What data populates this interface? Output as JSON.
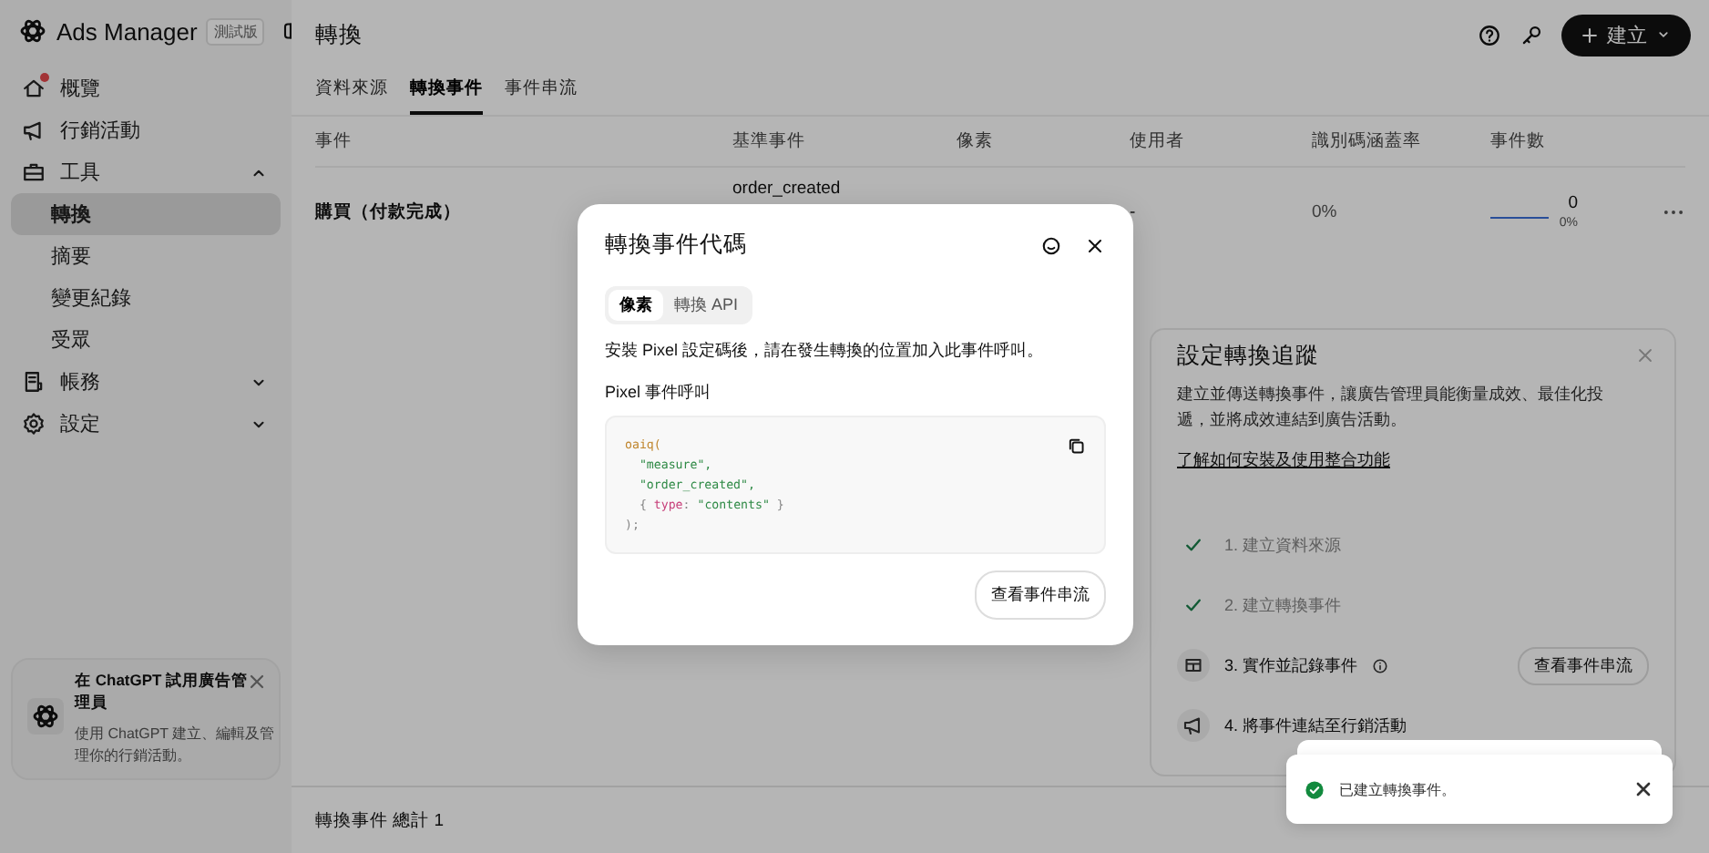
{
  "app": {
    "name": "Ads Manager",
    "badge": "測試版"
  },
  "sidebar": {
    "items": [
      {
        "label": "概覽",
        "notification": true,
        "selected": false
      },
      {
        "label": "行銷活動",
        "notification": false,
        "selected": false
      },
      {
        "label": "工具",
        "notification": false,
        "selected": false,
        "expanded": true,
        "children": [
          {
            "label": "轉換",
            "selected": true
          },
          {
            "label": "摘要",
            "selected": false
          },
          {
            "label": "變更紀錄",
            "selected": false
          },
          {
            "label": "受眾",
            "selected": false
          }
        ]
      },
      {
        "label": "帳務",
        "notification": false,
        "selected": false,
        "expanded": false
      },
      {
        "label": "設定",
        "notification": false,
        "selected": false,
        "expanded": false
      }
    ]
  },
  "promo": {
    "title": "在 ChatGPT 試用廣告管理員",
    "body": "使用 ChatGPT 建立、編輯及管理你的行銷活動。"
  },
  "header": {
    "title": "轉換",
    "create_button": "建立"
  },
  "tabs": [
    {
      "label": "資料來源",
      "selected": false
    },
    {
      "label": "轉換事件",
      "selected": true
    },
    {
      "label": "事件串流",
      "selected": false
    }
  ],
  "table": {
    "columns": [
      "事件",
      "基準事件",
      "像素",
      "使用者",
      "識別碼涵蓋率",
      "事件數"
    ],
    "rows": [
      {
        "event": "購買（付款完成）",
        "base_event": "order_created",
        "users": "-",
        "coverage": "0%",
        "count": "0",
        "count_share": "0%"
      }
    ]
  },
  "footer": "轉換事件 總計 1",
  "modal": {
    "title": "轉換事件代碼",
    "tabs": [
      {
        "label": "像素",
        "selected": true
      },
      {
        "label": "轉換 API",
        "selected": false
      }
    ],
    "description": "安裝 Pixel 設定碼後，請在發生轉換的位置加入此事件呼叫。",
    "code_label": "Pixel 事件呼叫",
    "code": [
      [
        {
          "text": "oaiq(",
          "kind": "fn"
        }
      ],
      [
        {
          "text": "  \"measure\",",
          "kind": "string"
        }
      ],
      [
        {
          "text": "  \"order_created\",",
          "kind": "string"
        }
      ],
      [
        {
          "text": "  { ",
          "kind": "punct"
        },
        {
          "text": "type",
          "kind": "key"
        },
        {
          "text": ": ",
          "kind": "punct"
        },
        {
          "text": "\"contents\"",
          "kind": "string"
        },
        {
          "text": " }",
          "kind": "punct"
        }
      ],
      [
        {
          "text": ");",
          "kind": "punct"
        }
      ]
    ],
    "button": "查看事件串流"
  },
  "setup": {
    "title": "設定轉換追蹤",
    "body": "建立並傳送轉換事件，讓廣告管理員能衡量成效、最佳化投遞，並將成效連結到廣告活動。",
    "link": "了解如何安裝及使用整合功能",
    "steps": [
      {
        "label": "1. 建立資料來源",
        "done": true,
        "info": false
      },
      {
        "label": "2. 建立轉換事件",
        "done": true,
        "info": false
      },
      {
        "label": "3. 實作並記錄事件",
        "done": false,
        "info": true,
        "button": "查看事件串流"
      },
      {
        "label": "4. 將事件連結至行銷活動",
        "done": false,
        "info": false
      }
    ]
  },
  "toast": {
    "message": "已建立轉換事件。"
  }
}
